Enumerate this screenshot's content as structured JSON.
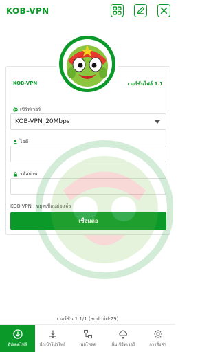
{
  "header": {
    "title": "KOB-VPN",
    "actions": [
      {
        "name": "grid-icon"
      },
      {
        "name": "edit-icon"
      },
      {
        "name": "close-icon"
      }
    ]
  },
  "card": {
    "app_name": "KOB-VPN",
    "file_version": "เวอร์ชั่นไฟล์ 1.1",
    "server_label": "เซิร์ฟเวอร์",
    "server_value": "KOB-VPN_20Mbps",
    "id_label": "ไอดี",
    "id_value": "",
    "password_label": "รหัสผ่าน",
    "password_value": "",
    "status": "KOB-VPN : หยุดเชื่อมต่อแล้ว",
    "connect_label": "เชื่อมต่อ"
  },
  "version_text": "เวอร์ชั่น 1.1/1 (android-29)",
  "nav": [
    {
      "label": "อัปเดตไฟล์",
      "icon": "download-circle-icon",
      "active": true
    },
    {
      "label": "นำเข้าโปรไฟล์",
      "icon": "import-icon",
      "active": false
    },
    {
      "label": "เพย์โหลด",
      "icon": "network-icon",
      "active": false
    },
    {
      "label": "เพิ่มเซิร์ฟเวอร์",
      "icon": "cloud-sync-icon",
      "active": false
    },
    {
      "label": "การตั้งค่า",
      "icon": "settings-icon",
      "active": false
    }
  ],
  "colors": {
    "accent": "#0b9a2a"
  }
}
